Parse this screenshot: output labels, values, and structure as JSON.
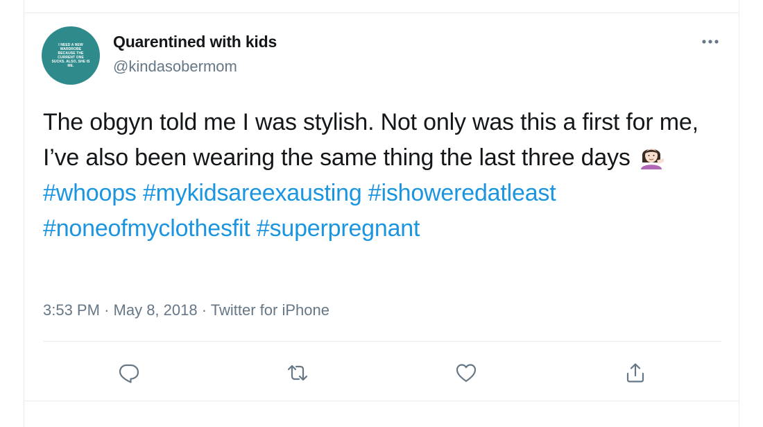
{
  "tweet": {
    "display_name": "Quarentined with kids",
    "handle": "@kindasobermom",
    "avatar_text": "I NEED A NEW WARDROBE BECAUSE THE CURRENT ONE SUCKS. ALSO, SHE IS ME.",
    "text_plain": "The obgyn told me I was stylish. Not only was this a first for me, I’ve also been wearing the same thing the last three days",
    "emoji": "woman-tipping-hand-emoji",
    "hashtags": [
      "#whoops",
      "#mykidsareexausting",
      "#ishoweredatleast",
      "#noneofmyclothesfit",
      "#superpregnant"
    ],
    "time": "3:53 PM",
    "separator": "·",
    "date": "May 8, 2018",
    "source": "Twitter for iPhone"
  },
  "colors": {
    "hashtag": "#1b95e0",
    "text": "#14171a",
    "secondary": "#657786",
    "avatar_bg": "#2f8a8c",
    "divider": "#e6ecf0"
  },
  "actions": {
    "icons": [
      "reply-icon",
      "retweet-icon",
      "like-icon",
      "share-icon"
    ]
  },
  "menu": {
    "icon": "more-options-icon"
  }
}
